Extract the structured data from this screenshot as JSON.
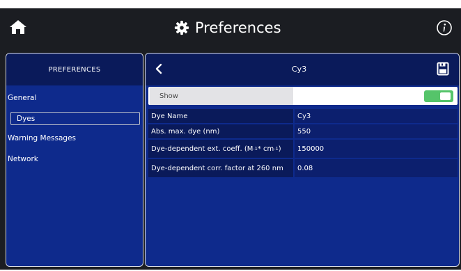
{
  "header": {
    "title": "Preferences",
    "home_icon": "home-icon",
    "gear_icon": "gear-icon",
    "info_icon": "info-icon"
  },
  "sidebar": {
    "title": "PREFERENCES",
    "items": [
      {
        "label": "General",
        "selected": false
      },
      {
        "label": "Dyes",
        "selected": true
      },
      {
        "label": "Warning Messages",
        "selected": false
      },
      {
        "label": "Network",
        "selected": false
      }
    ]
  },
  "detail": {
    "title": "Cy3",
    "back_icon": "chevron-left-icon",
    "save_icon": "save-icon",
    "show": {
      "label": "Show",
      "enabled": true
    },
    "rows": [
      {
        "label": "Dye Name",
        "value": "Cy3"
      },
      {
        "label": "Abs. max. dye (nm)",
        "value": "550"
      },
      {
        "label_pre": "Dye-dependent ext. coeff. (M",
        "label_sup1": "-1",
        "label_mid": " * cm",
        "label_sup2": "-1",
        "label_post": ")",
        "value": "150000"
      },
      {
        "label": "Dye-dependent corr. factor at 260 nm",
        "value": "0.08"
      }
    ]
  },
  "colors": {
    "panel_blue": "#0e2a8c",
    "header_navy": "#0a1a5a",
    "topbar": "#1b1d22",
    "toggle_green": "#55c46a"
  }
}
